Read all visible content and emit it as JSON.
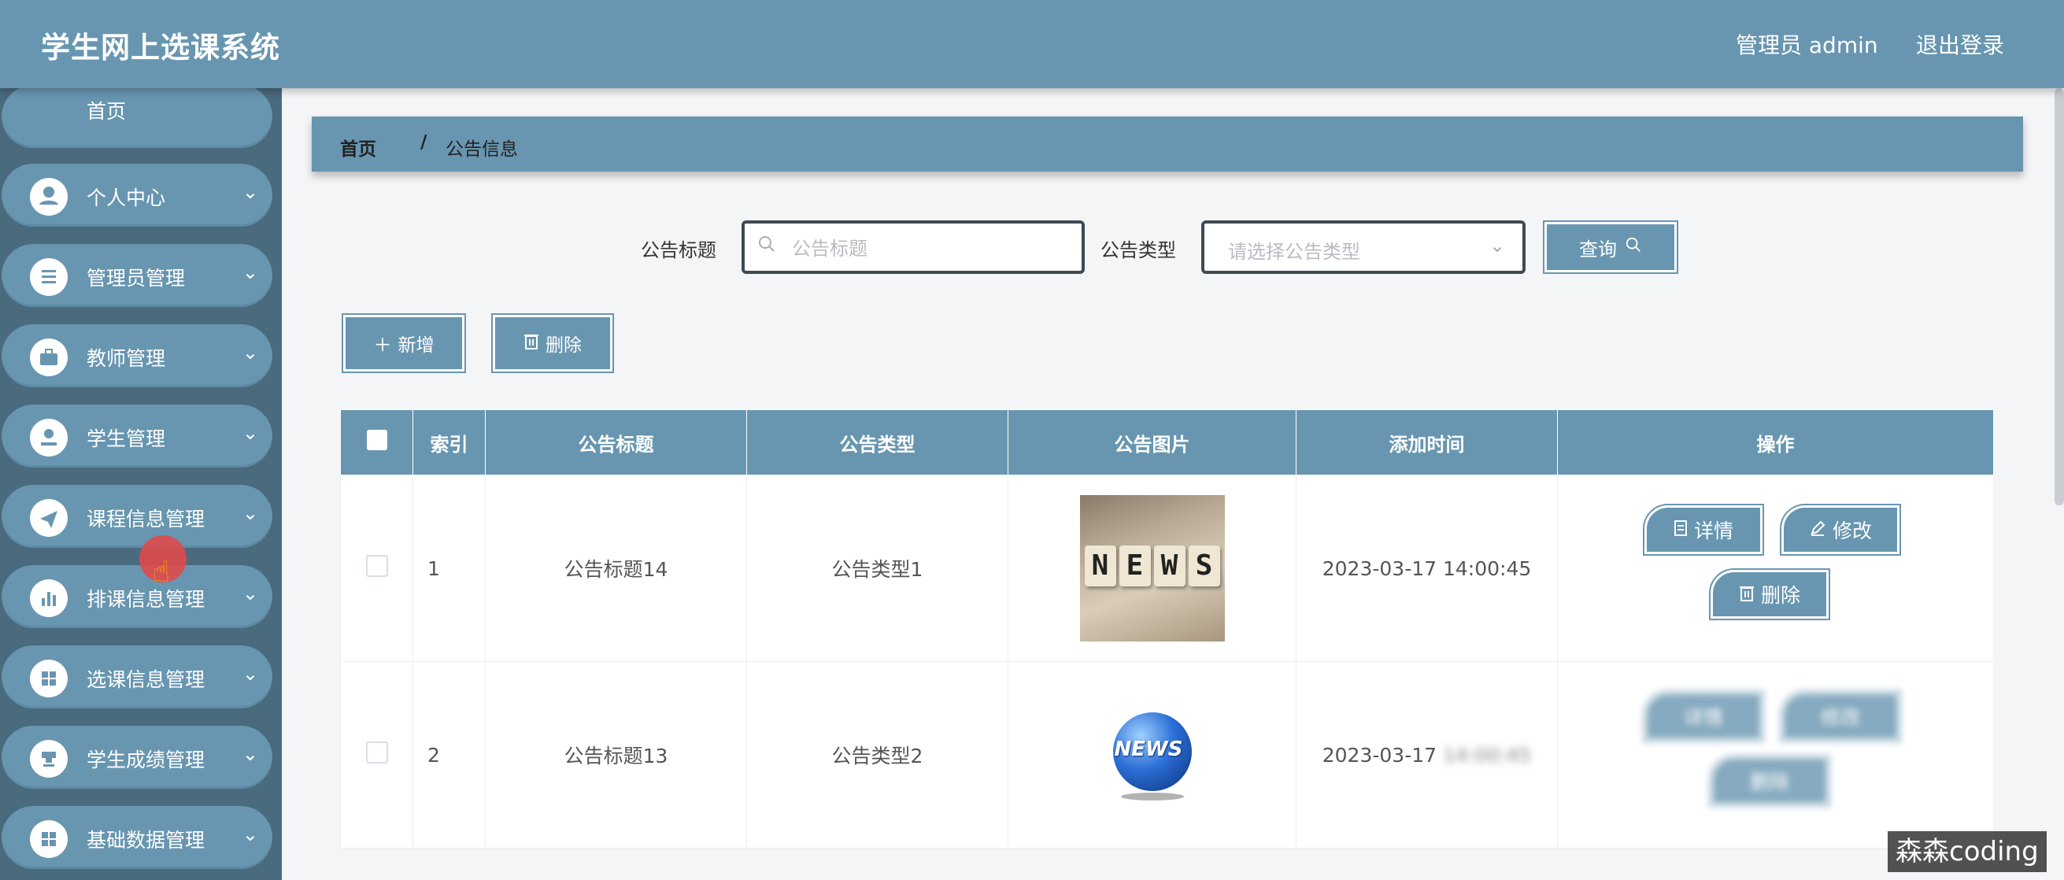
{
  "header": {
    "app_title": "学生网上选课系统",
    "admin_label": "管理员 admin",
    "logout_label": "退出登录"
  },
  "sidebar": {
    "home_label": "首页",
    "items": [
      {
        "label": "个人中心",
        "icon": "user-icon"
      },
      {
        "label": "管理员管理",
        "icon": "list-icon"
      },
      {
        "label": "教师管理",
        "icon": "briefcase-icon"
      },
      {
        "label": "学生管理",
        "icon": "student-icon"
      },
      {
        "label": "课程信息管理",
        "icon": "send-icon"
      },
      {
        "label": "排课信息管理",
        "icon": "bar-chart-icon"
      },
      {
        "label": "选课信息管理",
        "icon": "grid-icon"
      },
      {
        "label": "学生成绩管理",
        "icon": "stamp-icon"
      },
      {
        "label": "基础数据管理",
        "icon": "grid-icon"
      }
    ]
  },
  "breadcrumb": {
    "home": "首页",
    "separator": "/",
    "current": "公告信息"
  },
  "search": {
    "title_label": "公告标题",
    "title_placeholder": "公告标题",
    "type_label": "公告类型",
    "type_placeholder": "请选择公告类型",
    "query_label": "查询"
  },
  "actions": {
    "add_label": "新增",
    "delete_label": "删除"
  },
  "table": {
    "columns": [
      "索引",
      "公告标题",
      "公告类型",
      "公告图片",
      "添加时间",
      "操作"
    ],
    "rows": [
      {
        "index": "1",
        "title": "公告标题14",
        "type": "公告类型1",
        "image": "news-dice-image",
        "time": "2023-03-17 14:00:45"
      },
      {
        "index": "2",
        "title": "公告标题13",
        "type": "公告类型2",
        "image": "news-globe-image",
        "time": "2023-03-17"
      }
    ],
    "op_detail": "详情",
    "op_edit": "修改",
    "op_delete": "删除",
    "image_text_1": "NEWS",
    "image_text_2": "NEWS"
  },
  "watermark": "森森coding",
  "colors": {
    "primary": "#6896b0",
    "sidebar_bg": "#4a6a7e",
    "page_bg": "#f4f5f7"
  }
}
